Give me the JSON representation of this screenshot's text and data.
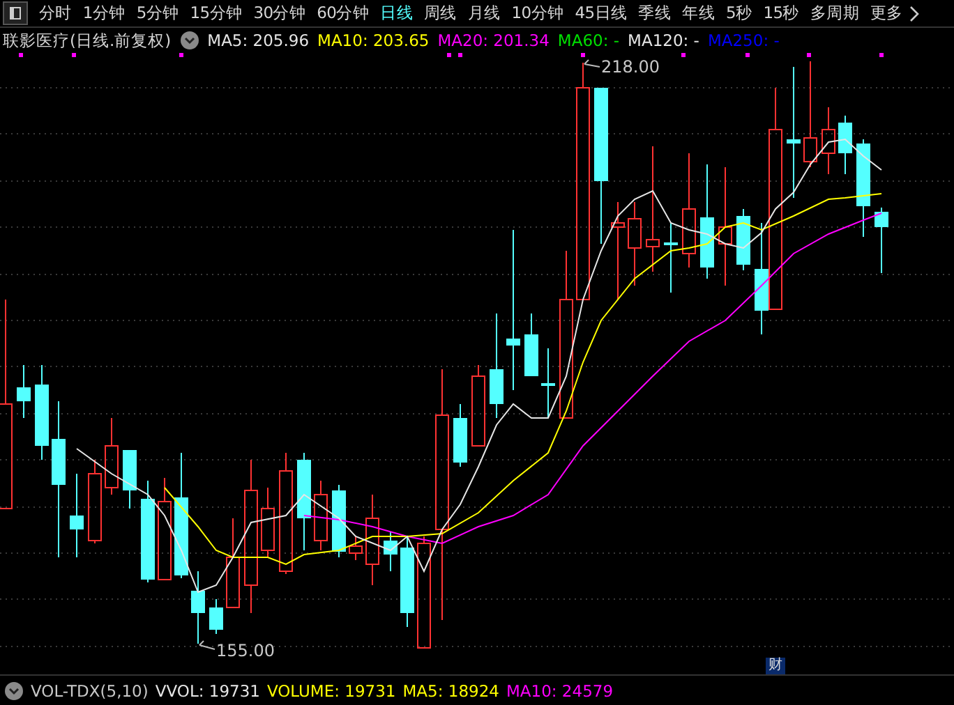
{
  "periods": [
    {
      "label": "分时",
      "selected": false
    },
    {
      "label": "1分钟",
      "selected": false
    },
    {
      "label": "5分钟",
      "selected": false
    },
    {
      "label": "15分钟",
      "selected": false
    },
    {
      "label": "30分钟",
      "selected": false
    },
    {
      "label": "60分钟",
      "selected": false
    },
    {
      "label": "日线",
      "selected": true
    },
    {
      "label": "周线",
      "selected": false
    },
    {
      "label": "月线",
      "selected": false
    },
    {
      "label": "10分钟",
      "selected": false
    },
    {
      "label": "45日线",
      "selected": false
    },
    {
      "label": "季线",
      "selected": false
    },
    {
      "label": "年线",
      "selected": false
    },
    {
      "label": "5秒",
      "selected": false
    },
    {
      "label": "15秒",
      "selected": false
    },
    {
      "label": "多周期",
      "selected": false
    },
    {
      "label": "更多",
      "selected": false
    }
  ],
  "price_legend": {
    "title": "联影医疗(日线.前复权)",
    "items": [
      {
        "text": "MA5: 205.96",
        "color": "#e6e6e6"
      },
      {
        "text": "MA10: 203.65",
        "color": "#ffff00"
      },
      {
        "text": "MA20: 201.34",
        "color": "#ff00ff"
      },
      {
        "text": "MA60: -",
        "color": "#00e000"
      },
      {
        "text": "MA120: -",
        "color": "#e6e6e6"
      },
      {
        "text": "MA250: -",
        "color": "#0000ff"
      }
    ]
  },
  "chart": {
    "high_label": "218.00",
    "low_label": "155.00",
    "event_marker": "财"
  },
  "volume_legend": {
    "title": "VOL-TDX(5,10)",
    "items": [
      {
        "text": "VVOL: 19731",
        "color": "#e6e6e6"
      },
      {
        "text": "VOLUME: 19731",
        "color": "#ffff00"
      },
      {
        "text": "MA5: 18924",
        "color": "#ffff00"
      },
      {
        "text": "MA10: 24579",
        "color": "#ff00ff"
      }
    ]
  }
}
